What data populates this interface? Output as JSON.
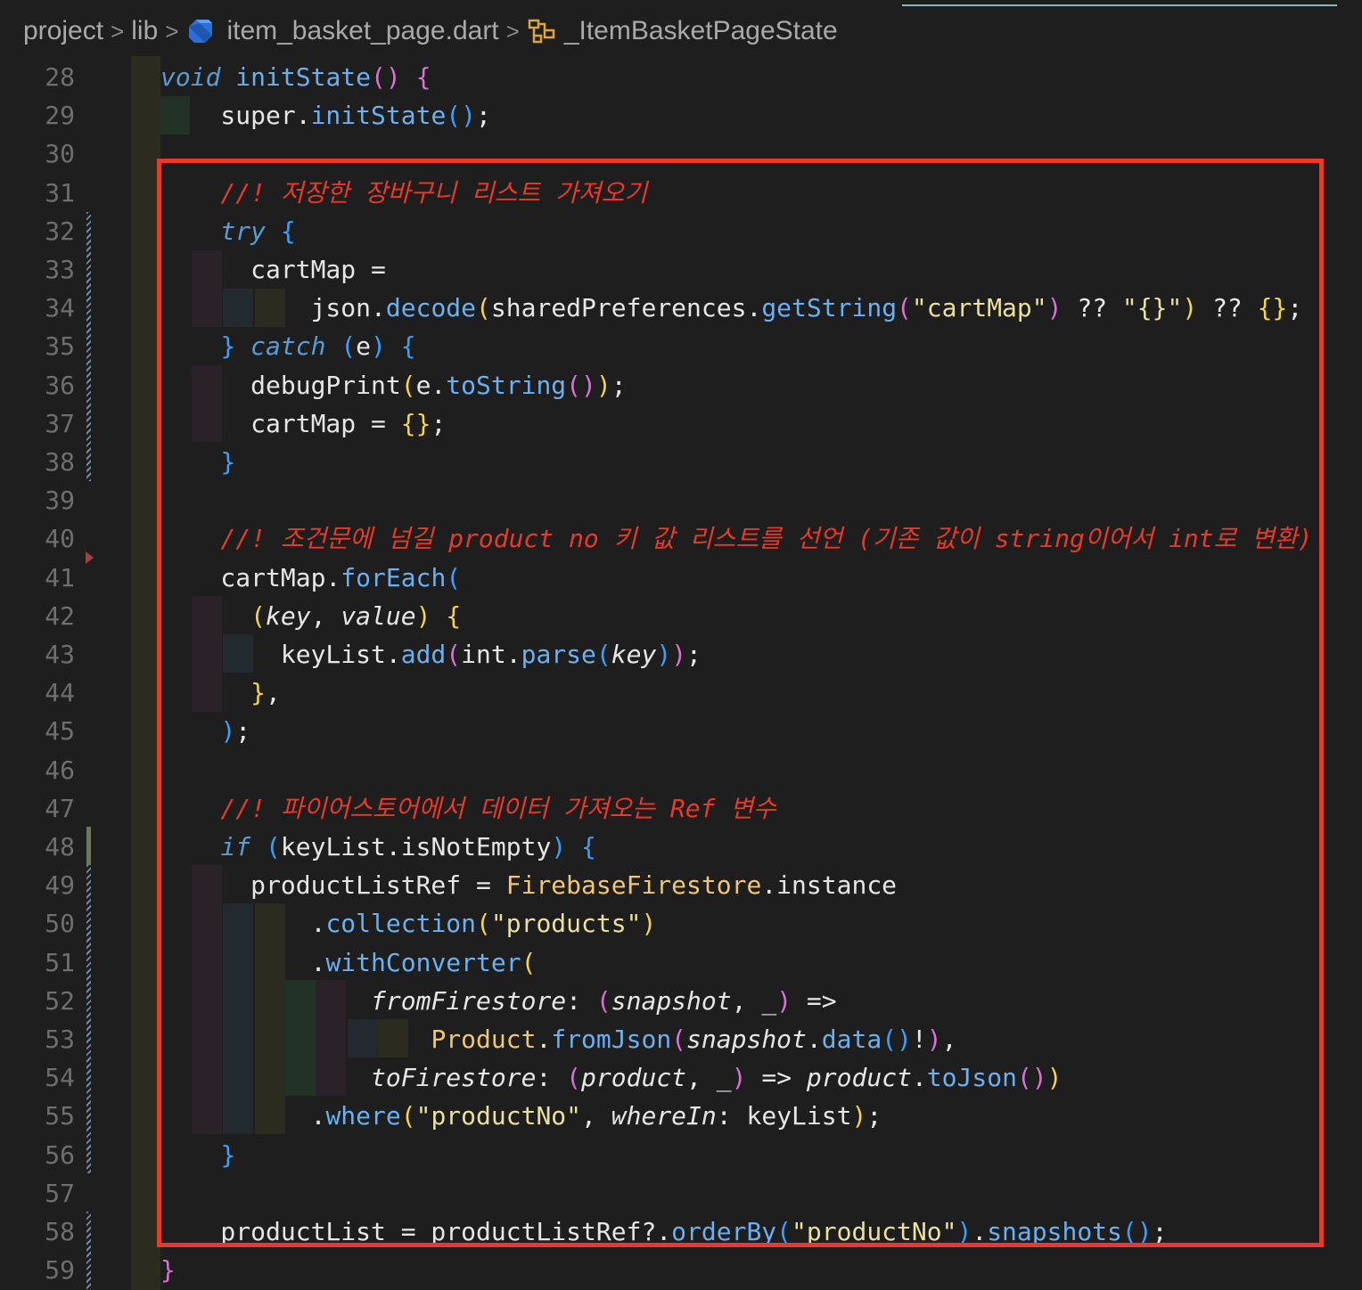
{
  "breadcrumb": {
    "items": [
      "project",
      "lib",
      "item_basket_page.dart",
      "_ItemBasketPageState"
    ],
    "separator": ">"
  },
  "editor": {
    "highlight_color": "#e8392a",
    "lines": [
      {
        "n": "28",
        "tokens": [
          [
            "void",
            "kw"
          ],
          [
            " ",
            ""
          ],
          [
            "initState",
            "fn"
          ],
          [
            "()",
            "br2"
          ],
          [
            " ",
            ""
          ],
          [
            "{",
            "br2"
          ]
        ]
      },
      {
        "n": "29",
        "tokens": [
          [
            "    super",
            ""
          ],
          [
            ".",
            ""
          ],
          [
            "initState",
            "fn"
          ],
          [
            "()",
            "br3"
          ],
          [
            ";",
            ""
          ]
        ]
      },
      {
        "n": "30",
        "tokens": []
      },
      {
        "n": "31",
        "tokens": [
          [
            "    //! 저장한 장바구니 리스트 가져오기",
            "cmt"
          ]
        ]
      },
      {
        "n": "32",
        "tokens": [
          [
            "    ",
            ""
          ],
          [
            "try",
            "kw"
          ],
          [
            " ",
            ""
          ],
          [
            "{",
            "br3"
          ]
        ]
      },
      {
        "n": "33",
        "tokens": [
          [
            "      cartMap =",
            ""
          ]
        ]
      },
      {
        "n": "34",
        "tokens": [
          [
            "          json.",
            ""
          ],
          [
            "decode",
            "fn"
          ],
          [
            "(",
            "br1"
          ],
          [
            "sharedPreferences.",
            ""
          ],
          [
            "getString",
            "fn"
          ],
          [
            "(",
            "br2"
          ],
          [
            "\"cartMap\"",
            "str"
          ],
          [
            ")",
            "br2"
          ],
          [
            " ?? ",
            ""
          ],
          [
            "\"{}\"",
            "str"
          ],
          [
            ")",
            "br1"
          ],
          [
            " ?? ",
            ""
          ],
          [
            "{}",
            "br1"
          ],
          [
            ";",
            ""
          ]
        ]
      },
      {
        "n": "35",
        "tokens": [
          [
            "    ",
            ""
          ],
          [
            "}",
            "br3"
          ],
          [
            " ",
            ""
          ],
          [
            "catch",
            "kw"
          ],
          [
            " ",
            ""
          ],
          [
            "(",
            "br3"
          ],
          [
            "e",
            ""
          ],
          [
            ")",
            "br3"
          ],
          [
            " ",
            ""
          ],
          [
            "{",
            "br3"
          ]
        ]
      },
      {
        "n": "36",
        "tokens": [
          [
            "      debugPrint",
            ""
          ],
          [
            "(",
            "br1"
          ],
          [
            "e.",
            ""
          ],
          [
            "toString",
            "fn"
          ],
          [
            "()",
            "br2"
          ],
          [
            ")",
            "br1"
          ],
          [
            ";",
            ""
          ]
        ]
      },
      {
        "n": "37",
        "tokens": [
          [
            "      cartMap = ",
            ""
          ],
          [
            "{}",
            "br1"
          ],
          [
            ";",
            ""
          ]
        ]
      },
      {
        "n": "38",
        "tokens": [
          [
            "    ",
            ""
          ],
          [
            "}",
            "br3"
          ]
        ]
      },
      {
        "n": "39",
        "tokens": []
      },
      {
        "n": "40",
        "tokens": [
          [
            "    //! 조건문에 넘길 product no 키 값 리스트를 선언 (기존 값이 string이어서 int로 변환)",
            "cmt"
          ]
        ]
      },
      {
        "n": "41",
        "tokens": [
          [
            "    cartMap.",
            ""
          ],
          [
            "forEach",
            "fn"
          ],
          [
            "(",
            "br3"
          ]
        ]
      },
      {
        "n": "42",
        "tokens": [
          [
            "      ",
            ""
          ],
          [
            "(",
            "br1"
          ],
          [
            "key",
            "it"
          ],
          [
            ", ",
            ""
          ],
          [
            "value",
            "it"
          ],
          [
            ")",
            "br1"
          ],
          [
            " ",
            ""
          ],
          [
            "{",
            "br1"
          ]
        ]
      },
      {
        "n": "43",
        "tokens": [
          [
            "        keyList.",
            ""
          ],
          [
            "add",
            "fn"
          ],
          [
            "(",
            "br2"
          ],
          [
            "int.",
            ""
          ],
          [
            "parse",
            "fn"
          ],
          [
            "(",
            "br3"
          ],
          [
            "key",
            "it"
          ],
          [
            ")",
            "br3"
          ],
          [
            ")",
            "br2"
          ],
          [
            ";",
            ""
          ]
        ]
      },
      {
        "n": "44",
        "tokens": [
          [
            "      ",
            ""
          ],
          [
            "}",
            "br1"
          ],
          [
            ",",
            ""
          ]
        ]
      },
      {
        "n": "45",
        "tokens": [
          [
            "    ",
            ""
          ],
          [
            ")",
            "br3"
          ],
          [
            ";",
            ""
          ]
        ]
      },
      {
        "n": "46",
        "tokens": []
      },
      {
        "n": "47",
        "tokens": [
          [
            "    //! 파이어스토어에서 데이터 가져오는 Ref 변수",
            "cmt"
          ]
        ]
      },
      {
        "n": "48",
        "tokens": [
          [
            "    ",
            ""
          ],
          [
            "if",
            "kw"
          ],
          [
            " ",
            ""
          ],
          [
            "(",
            "br3"
          ],
          [
            "keyList.isNotEmpty",
            ""
          ],
          [
            ")",
            "br3"
          ],
          [
            " ",
            ""
          ],
          [
            "{",
            "br3"
          ]
        ]
      },
      {
        "n": "49",
        "tokens": [
          [
            "      productListRef = ",
            ""
          ],
          [
            "FirebaseFirestore",
            "ty"
          ],
          [
            ".instance",
            ""
          ]
        ]
      },
      {
        "n": "50",
        "tokens": [
          [
            "          .",
            ""
          ],
          [
            "collection",
            "fn"
          ],
          [
            "(",
            "br1"
          ],
          [
            "\"products\"",
            "str"
          ],
          [
            ")",
            "br1"
          ]
        ]
      },
      {
        "n": "51",
        "tokens": [
          [
            "          .",
            ""
          ],
          [
            "withConverter",
            "fn"
          ],
          [
            "(",
            "br1"
          ]
        ]
      },
      {
        "n": "52",
        "tokens": [
          [
            "              ",
            ""
          ],
          [
            "fromFirestore",
            "it"
          ],
          [
            ": ",
            ""
          ],
          [
            "(",
            "br2"
          ],
          [
            "snapshot",
            "it"
          ],
          [
            ", ",
            ""
          ],
          [
            "_",
            "it"
          ],
          [
            ")",
            "br2"
          ],
          [
            " =>",
            ""
          ]
        ]
      },
      {
        "n": "53",
        "tokens": [
          [
            "                  ",
            ""
          ],
          [
            "Product",
            "ty"
          ],
          [
            ".",
            ""
          ],
          [
            "fromJson",
            "fn"
          ],
          [
            "(",
            "br2"
          ],
          [
            "snapshot",
            "it"
          ],
          [
            ".",
            ""
          ],
          [
            "data",
            "fn"
          ],
          [
            "()",
            "br3"
          ],
          [
            "!",
            ""
          ],
          [
            ")",
            "br2"
          ],
          [
            ",",
            ""
          ]
        ]
      },
      {
        "n": "54",
        "tokens": [
          [
            "              ",
            ""
          ],
          [
            "toFirestore",
            "it"
          ],
          [
            ": ",
            ""
          ],
          [
            "(",
            "br2"
          ],
          [
            "product",
            "it"
          ],
          [
            ", ",
            ""
          ],
          [
            "_",
            "it"
          ],
          [
            ")",
            "br2"
          ],
          [
            " => ",
            ""
          ],
          [
            "product",
            "it"
          ],
          [
            ".",
            ""
          ],
          [
            "toJson",
            "fn"
          ],
          [
            "()",
            "br2"
          ],
          [
            ")",
            "br1"
          ]
        ]
      },
      {
        "n": "55",
        "tokens": [
          [
            "          .",
            ""
          ],
          [
            "where",
            "fn"
          ],
          [
            "(",
            "br1"
          ],
          [
            "\"productNo\"",
            "str"
          ],
          [
            ", ",
            ""
          ],
          [
            "whereIn",
            "it"
          ],
          [
            ": keyList",
            ""
          ],
          [
            ")",
            "br1"
          ],
          [
            ";",
            ""
          ]
        ]
      },
      {
        "n": "56",
        "tokens": [
          [
            "    ",
            ""
          ],
          [
            "}",
            "br3"
          ]
        ]
      },
      {
        "n": "57",
        "tokens": []
      },
      {
        "n": "58",
        "tokens": [
          [
            "    productList = productListRef?.",
            ""
          ],
          [
            "orderBy",
            "fn"
          ],
          [
            "(",
            "br3"
          ],
          [
            "\"productNo\"",
            "str"
          ],
          [
            ")",
            "br3"
          ],
          [
            ".",
            ""
          ],
          [
            "snapshots",
            "fn"
          ],
          [
            "()",
            "br3"
          ],
          [
            ";",
            ""
          ]
        ]
      },
      {
        "n": "59",
        "tokens": [
          [
            "",
            ""
          ],
          [
            "}",
            "br2"
          ]
        ]
      }
    ]
  }
}
